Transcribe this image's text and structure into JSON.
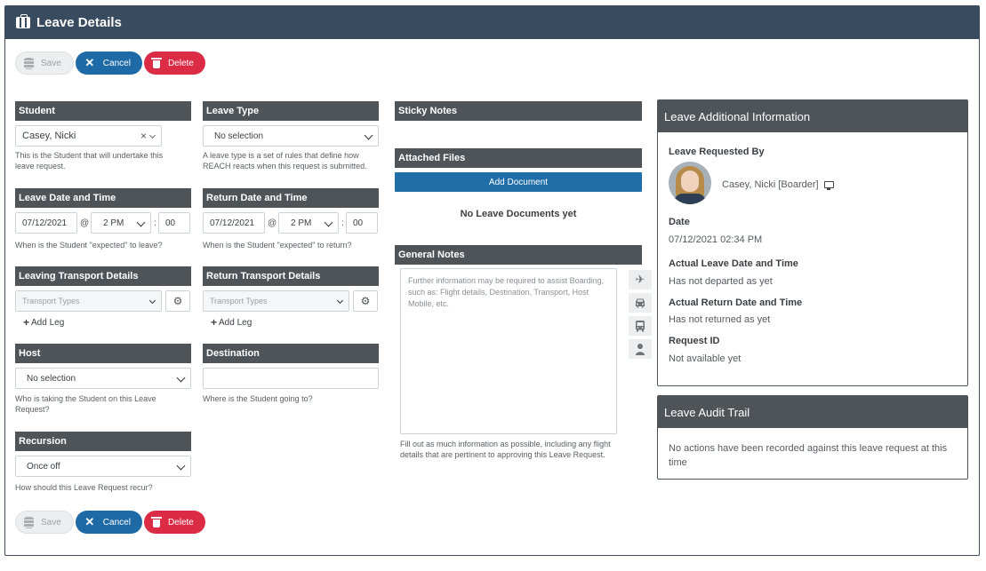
{
  "window": {
    "title": "Leave Details",
    "icon": "briefcase-icon"
  },
  "toolbar": {
    "save_label": "Save",
    "cancel_label": "Cancel",
    "delete_label": "Delete"
  },
  "student": {
    "heading": "Student",
    "value": "Casey, Nicki",
    "clear": "×",
    "help": "This is the Student that will undertake this leave request."
  },
  "leave_type": {
    "heading": "Leave Type",
    "value": "No selection",
    "help": "A leave type is a set of rules that define how REACH reacts when this request is submitted."
  },
  "leave_datetime": {
    "heading": "Leave Date and Time",
    "date": "07/12/2021",
    "at": "@",
    "hour": "2 PM",
    "colon": ":",
    "minute": "00",
    "help": "When is the Student \"expected\" to leave?"
  },
  "return_datetime": {
    "heading": "Return Date and Time",
    "date": "07/12/2021",
    "at": "@",
    "hour": "2 PM",
    "colon": ":",
    "minute": "00",
    "help": "When is the Student \"expected\" to return?"
  },
  "leaving_transport": {
    "heading": "Leaving Transport Details",
    "placeholder": "Transport Types",
    "add_leg": "Add Leg"
  },
  "return_transport": {
    "heading": "Return Transport Details",
    "placeholder": "Transport Types",
    "add_leg": "Add Leg"
  },
  "host": {
    "heading": "Host",
    "value": "No selection",
    "help": "Who is taking the Student on this Leave Request?"
  },
  "destination": {
    "heading": "Destination",
    "value": "",
    "help": "Where is the Student going to?"
  },
  "recursion": {
    "heading": "Recursion",
    "value": "Once off",
    "help": "How should this Leave Request recur?"
  },
  "sticky_notes": {
    "heading": "Sticky Notes"
  },
  "attached_files": {
    "heading": "Attached Files",
    "add_button": "Add Document",
    "empty": "No Leave Documents yet"
  },
  "general_notes": {
    "heading": "General Notes",
    "placeholder": "Further information may be required to assist Boarding, such as: Flight details, Destination, Transport, Host Mobile, etc.",
    "help": "Fill out as much information as possible, including any flight details that are pertinent to approving this Leave Request.",
    "icons": [
      "plane-icon",
      "car-icon",
      "bus-icon",
      "person-icon"
    ]
  },
  "additional_info": {
    "heading": "Leave Additional Information",
    "requested_by_label": "Leave Requested By",
    "requested_by_name": "Casey, Nicki [Boarder]",
    "date_label": "Date",
    "date_value": "07/12/2021 02:34 PM",
    "actual_leave_label": "Actual Leave Date and Time",
    "actual_leave_value": "Has not departed as yet",
    "actual_return_label": "Actual Return Date and Time",
    "actual_return_value": "Has not returned as yet",
    "request_id_label": "Request ID",
    "request_id_value": "Not available yet"
  },
  "audit_trail": {
    "heading": "Leave Audit Trail",
    "message": "No actions have been recorded against this leave request at this time"
  }
}
